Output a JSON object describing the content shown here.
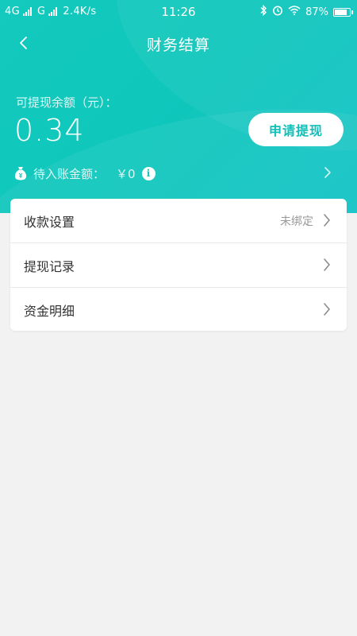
{
  "status_bar": {
    "network1": "4G",
    "network2": "G",
    "speed": "2.4K/s",
    "time": "11:26",
    "battery": "87%",
    "battery_level": 0.87
  },
  "nav": {
    "title": "财务结算"
  },
  "balance": {
    "label": "可提现余额（元）：",
    "value": "0.34",
    "withdraw_button": "申请提现"
  },
  "pending": {
    "label": "待入账金额：",
    "amount": "￥0"
  },
  "menu": {
    "items": [
      {
        "label": "收款设置",
        "value": "未绑定"
      },
      {
        "label": "提现记录",
        "value": ""
      },
      {
        "label": "资金明细",
        "value": ""
      }
    ]
  },
  "colors": {
    "accent": "#10bfb7",
    "background": "#f2f2f2"
  }
}
